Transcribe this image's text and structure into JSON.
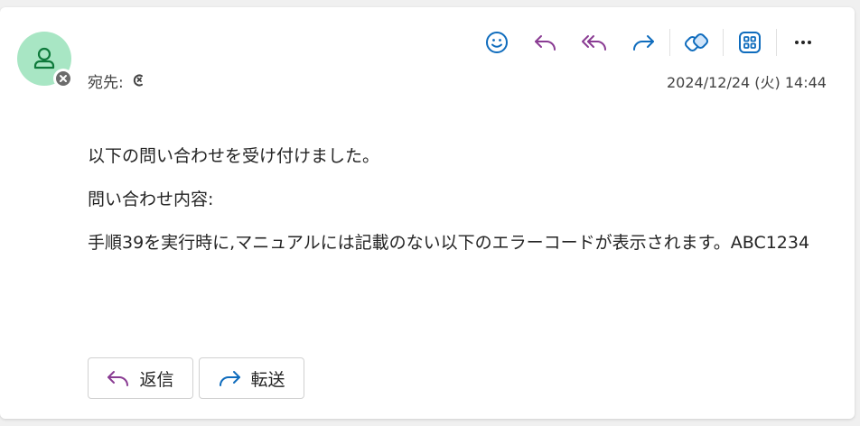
{
  "header": {
    "to_label": "宛先:",
    "date": "2024/12/24 (火) 14:44"
  },
  "toolbar": {
    "icons": [
      "emoji-icon",
      "reply-icon",
      "reply-all-icon",
      "forward-icon",
      "loop-icon",
      "apps-icon",
      "more-icon"
    ]
  },
  "body": {
    "paragraphs": [
      "以下の問い合わせを受け付けました。",
      "問い合わせ内容:",
      "手順39を実行時に,マニュアルには記載のない以下のエラーコードが表示されます。ABC1234"
    ]
  },
  "actions": {
    "reply_label": "返信",
    "forward_label": "転送"
  },
  "colors": {
    "avatar_bg": "#a8e6c4",
    "avatar_fg": "#0e7a3b",
    "accent_blue": "#0f6cbd",
    "accent_purple": "#8a3c93"
  }
}
